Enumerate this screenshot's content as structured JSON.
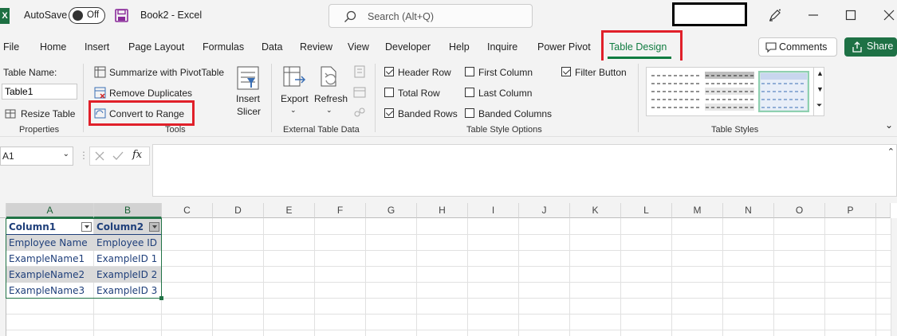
{
  "titlebar": {
    "app_icon_letter": "X",
    "autosave_label": "AutoSave",
    "autosave_state": "Off",
    "document_title": "Book2 - Excel",
    "search_placeholder": "Search (Alt+Q)"
  },
  "ribbon_tabs": [
    {
      "label": "File"
    },
    {
      "label": "Home"
    },
    {
      "label": "Insert"
    },
    {
      "label": "Page Layout"
    },
    {
      "label": "Formulas"
    },
    {
      "label": "Data"
    },
    {
      "label": "Review"
    },
    {
      "label": "View"
    },
    {
      "label": "Developer"
    },
    {
      "label": "Help"
    },
    {
      "label": "Inquire"
    },
    {
      "label": "Power Pivot"
    },
    {
      "label": "Table Design",
      "active": true
    }
  ],
  "actions": {
    "comments": "Comments",
    "share": "Share"
  },
  "ribbon": {
    "properties": {
      "table_name_label": "Table Name:",
      "table_name_value": "Table1",
      "resize_table": "Resize Table",
      "group_label": "Properties"
    },
    "tools": {
      "summarize": "Summarize with PivotTable",
      "remove_duplicates": "Remove Duplicates",
      "convert_to_range": "Convert to Range",
      "insert_slicer_line1": "Insert",
      "insert_slicer_line2": "Slicer",
      "group_label": "Tools"
    },
    "external": {
      "export": "Export",
      "refresh": "Refresh",
      "group_label": "External Table Data"
    },
    "style_options": {
      "header_row": {
        "label": "Header Row",
        "checked": true
      },
      "total_row": {
        "label": "Total Row",
        "checked": false
      },
      "banded_rows": {
        "label": "Banded Rows",
        "checked": true
      },
      "first_column": {
        "label": "First Column",
        "checked": false
      },
      "last_column": {
        "label": "Last Column",
        "checked": false
      },
      "banded_columns": {
        "label": "Banded Columns",
        "checked": false
      },
      "filter_button": {
        "label": "Filter Button",
        "checked": true
      },
      "group_label": "Table Style Options"
    },
    "styles": {
      "group_label": "Table Styles"
    }
  },
  "formula_bar": {
    "cell_reference": "A1",
    "fx_label": "fx",
    "formula": ""
  },
  "sheet": {
    "columns": [
      "A",
      "B",
      "C",
      "D",
      "E",
      "F",
      "G",
      "H",
      "I",
      "J",
      "K",
      "L",
      "M",
      "N",
      "O",
      "P"
    ],
    "table_header": [
      "Column1",
      "Column2"
    ],
    "table_rows": [
      [
        "Employee Name",
        "Employee ID"
      ],
      [
        "ExampleName1",
        "ExampleID 1"
      ],
      [
        "ExampleName2",
        "ExampleID 2"
      ],
      [
        "ExampleName3",
        "ExampleID 3"
      ]
    ]
  },
  "colors": {
    "accent_green": "#107c41",
    "highlight_red": "#e0202a",
    "table_text": "#1f3f7a",
    "band_fill": "#d9d9d9"
  }
}
